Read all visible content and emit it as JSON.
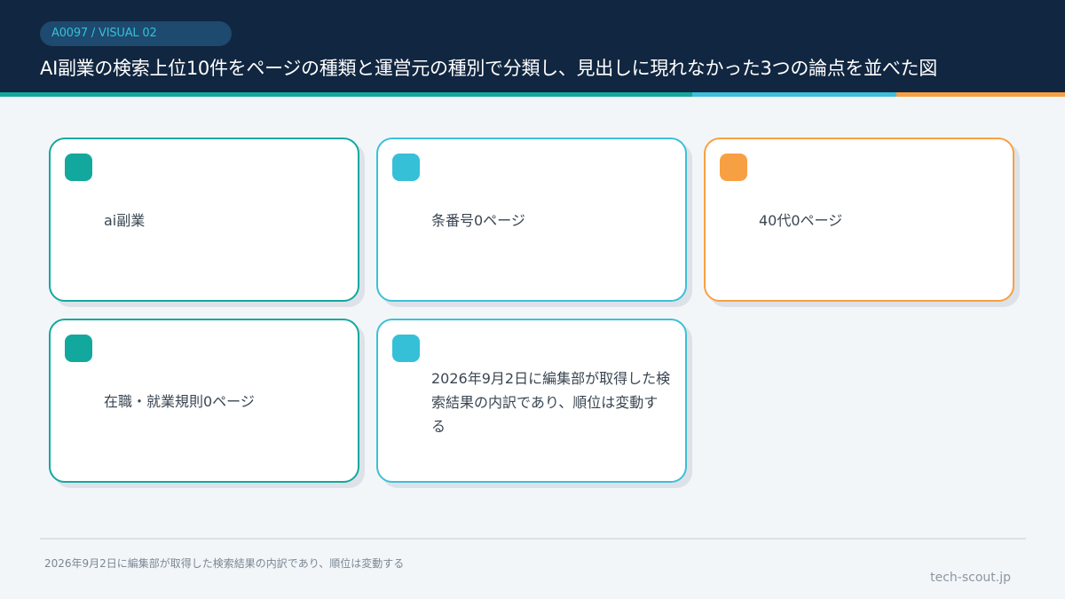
{
  "header": {
    "badge": "A0097 / VISUAL 02",
    "title": "AI副業の検索上位10件をページの種類と運営元の種別で分類し、見出しに現れなかった3つの論点を並べた図"
  },
  "cards": [
    {
      "label": "ai副業"
    },
    {
      "label": "条番号0ページ"
    },
    {
      "label": "40代0ページ"
    },
    {
      "label": "在職・就業規則0ページ"
    },
    {
      "label": "2026年9月2日に編集部が取得した検索結果の内訳であり、順位は変動する"
    }
  ],
  "footer": {
    "note": "2026年9月2日に編集部が取得した検索結果の内訳であり、順位は変動する",
    "site": "tech-scout.jp"
  },
  "colors": {
    "header_bg": "#112640",
    "teal": "#13a89e",
    "cyan": "#3dbfd9",
    "orange": "#f7a043"
  }
}
